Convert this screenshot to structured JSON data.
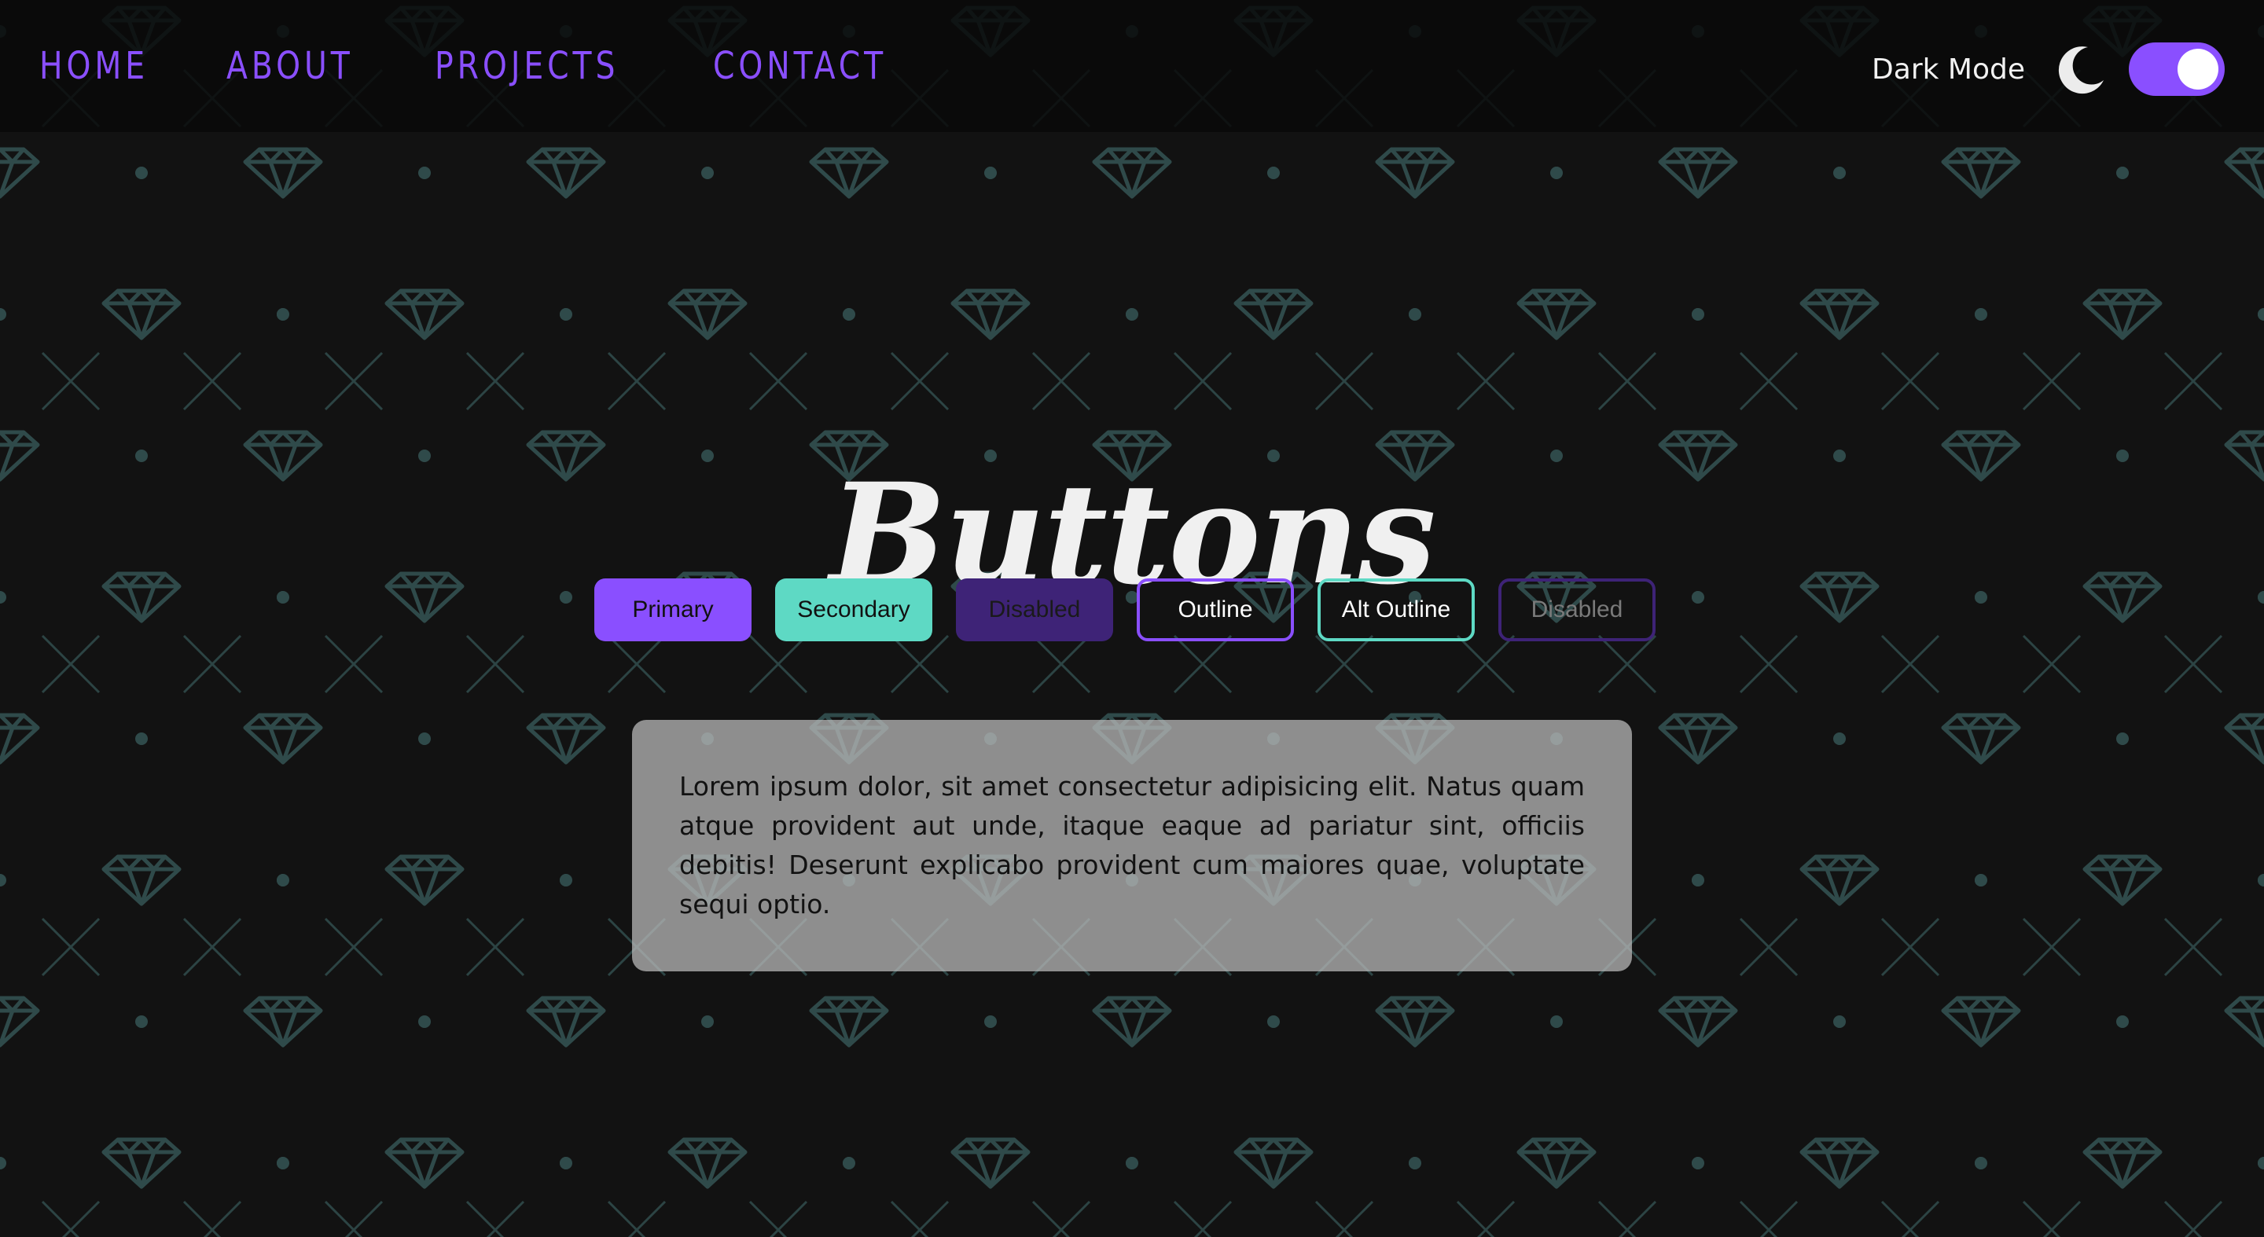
{
  "nav": {
    "links": [
      {
        "label": "HOME"
      },
      {
        "label": "ABOUT"
      },
      {
        "label": "PROJECTS"
      },
      {
        "label": "CONTACT"
      }
    ],
    "dark_mode_label": "Dark Mode",
    "toggle_on": true
  },
  "main": {
    "title": "Buttons",
    "buttons": [
      {
        "label": "Primary"
      },
      {
        "label": "Secondary"
      },
      {
        "label": "Disabled"
      },
      {
        "label": "Outline"
      },
      {
        "label": "Alt Outline"
      },
      {
        "label": "Disabled"
      }
    ],
    "card_text": "Lorem ipsum dolor, sit amet consectetur adipisicing elit. Natus quam atque provident aut unde, itaque eaque ad pariatur sint, officiis debitis! Deserunt explicabo provident cum maiores quae, voluptate sequi optio."
  },
  "colors": {
    "accent": "#8a4fff",
    "secondary": "#5ed9c4",
    "background": "#121212",
    "pattern": "#2f4a4a"
  },
  "icons": {
    "theme": "moon-icon",
    "pattern": "diamond-icon"
  }
}
